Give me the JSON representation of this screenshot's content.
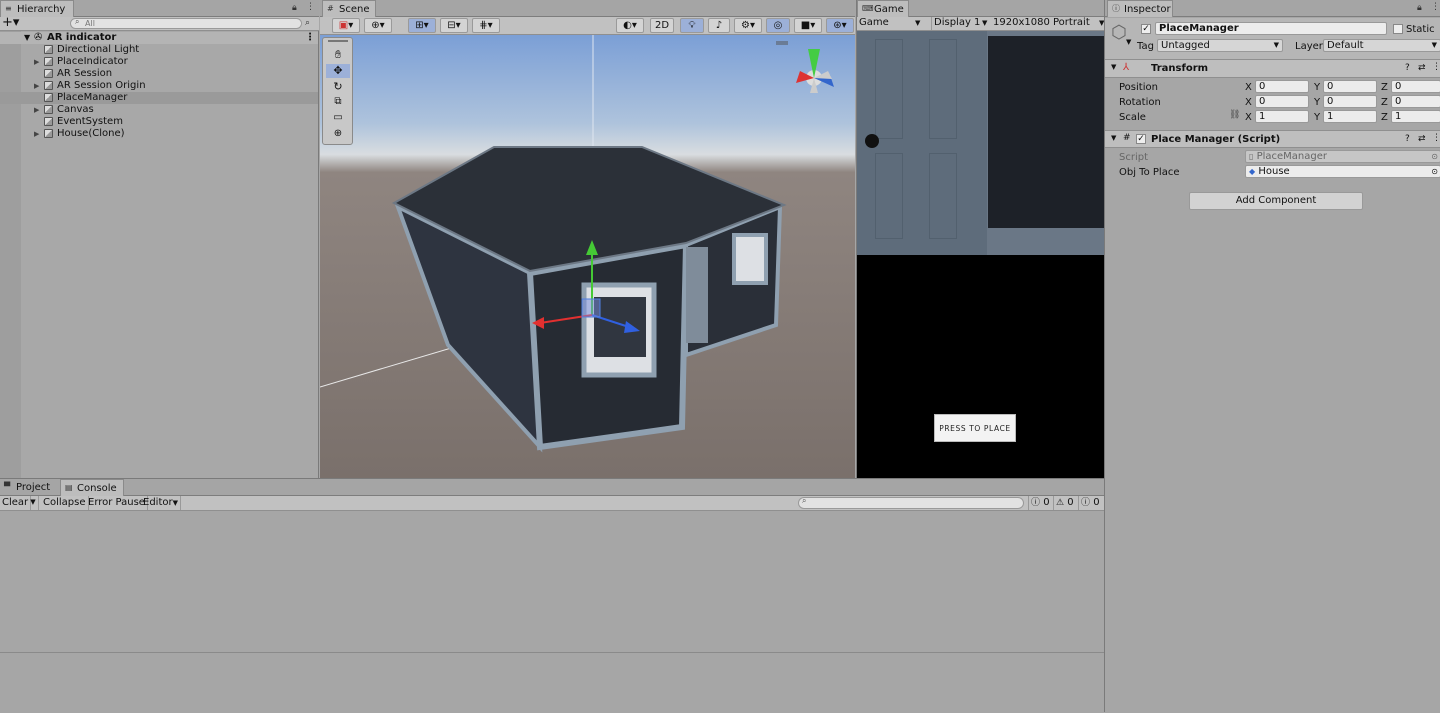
{
  "hierarchy": {
    "tab": "Hierarchy",
    "search_placeholder": "All",
    "root": "AR indicator",
    "items": [
      {
        "label": "Directional Light",
        "expandable": false
      },
      {
        "label": "PlaceIndicator",
        "expandable": true
      },
      {
        "label": "AR Session",
        "expandable": false
      },
      {
        "label": "AR Session Origin",
        "expandable": true
      },
      {
        "label": "PlaceManager",
        "expandable": false,
        "selected": true
      },
      {
        "label": "Canvas",
        "expandable": true
      },
      {
        "label": "EventSystem",
        "expandable": false
      },
      {
        "label": "House(Clone)",
        "expandable": true
      }
    ]
  },
  "scene": {
    "tab": "Scene",
    "mode_2d": "2D"
  },
  "game": {
    "tab": "Game",
    "view_select": "Game",
    "display": "Display 1",
    "resolution": "1920x1080 Portrait",
    "place_button": "PRESS TO PLACE"
  },
  "inspector": {
    "tab": "Inspector",
    "object_name": "PlaceManager",
    "static_label": "Static",
    "tag_label": "Tag",
    "tag_value": "Untagged",
    "layer_label": "Layer",
    "layer_value": "Default",
    "transform": {
      "title": "Transform",
      "position_label": "Position",
      "rotation_label": "Rotation",
      "scale_label": "Scale",
      "position": {
        "x": "0",
        "y": "0",
        "z": "0"
      },
      "rotation": {
        "x": "0",
        "y": "0",
        "z": "0"
      },
      "scale": {
        "x": "1",
        "y": "1",
        "z": "1"
      }
    },
    "component": {
      "title": "Place Manager (Script)",
      "script_label": "Script",
      "script_value": "PlaceManager",
      "obj_label": "Obj To Place",
      "obj_value": "House"
    },
    "add_component": "Add Component"
  },
  "bottom": {
    "tab_project": "Project",
    "tab_console": "Console",
    "clear": "Clear",
    "collapse": "Collapse",
    "error_pause": "Error Pause",
    "editor": "Editor",
    "info_count": "0",
    "warn_count": "0",
    "error_count": "0"
  }
}
